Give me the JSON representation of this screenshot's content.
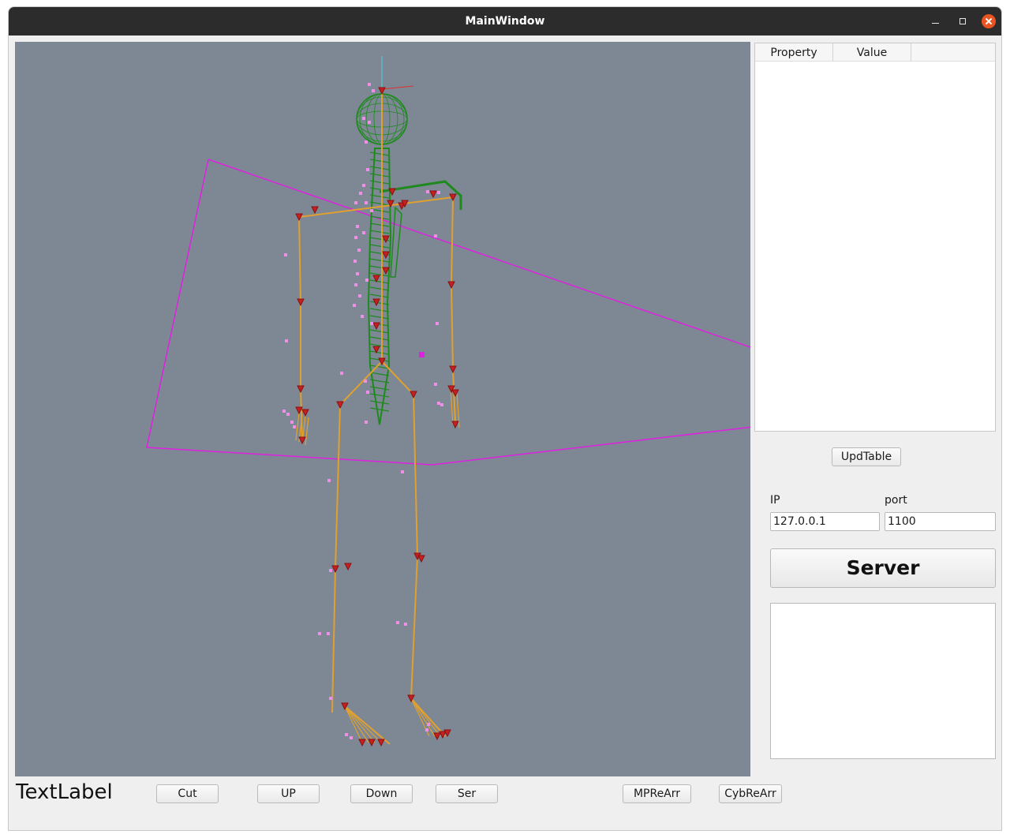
{
  "window": {
    "title": "MainWindow"
  },
  "table": {
    "headers": [
      "Property",
      "Value"
    ]
  },
  "buttons": {
    "upd_table": "UpdTable",
    "server": "Server",
    "cut": "Cut",
    "up": "UP",
    "down": "Down",
    "ser": "Ser",
    "mpre_arr": "MPReArr",
    "cybre_arr": "CybReArr"
  },
  "connection": {
    "ip_label": "IP",
    "ip_value": "127.0.0.1",
    "port_label": "port",
    "port_value": "1100"
  },
  "footer": {
    "text_label": "TextLabel"
  },
  "colors": {
    "viewport_bg": "#7d8894",
    "bone": "#e0a030",
    "mesh": "#1e8a1e",
    "marker": "#ef8fe8",
    "frustum": "#e020e0",
    "joint": "#8a1010"
  }
}
